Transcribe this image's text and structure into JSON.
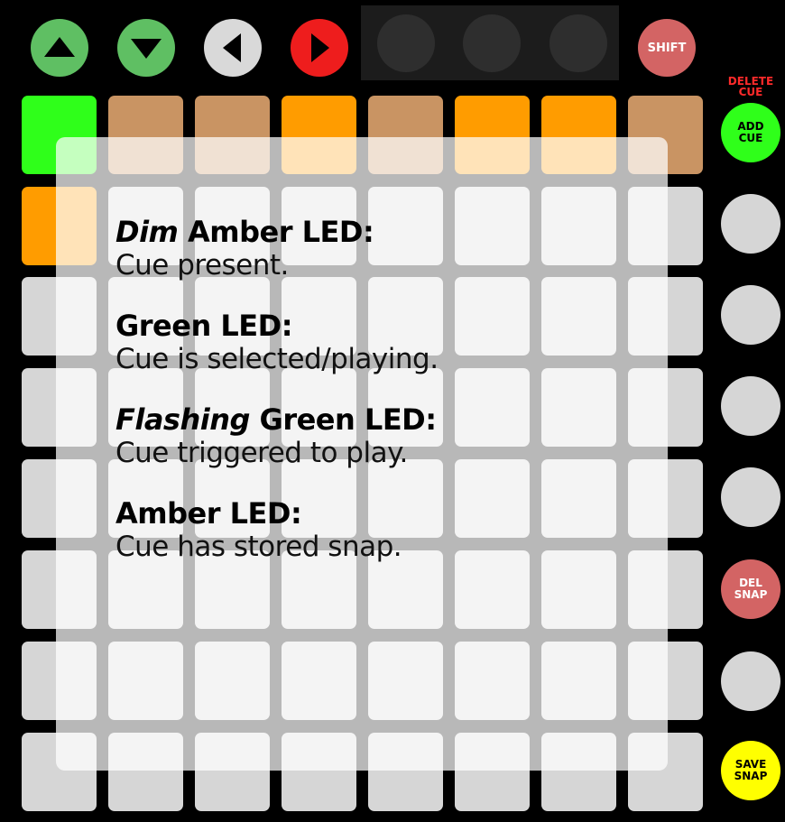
{
  "top_buttons": [
    {
      "name": "up-arrow-button",
      "icon": "triangle-up-icon",
      "color": "#5fbf63"
    },
    {
      "name": "down-arrow-button",
      "icon": "triangle-down-icon",
      "color": "#5fbf63"
    },
    {
      "name": "left-arrow-button",
      "icon": "triangle-left-icon",
      "color": "#d9d9d9"
    },
    {
      "name": "right-arrow-button",
      "icon": "triangle-right-icon",
      "color": "#ee1d1d"
    }
  ],
  "shift_label": "SHIFT",
  "delete_cue_label": "DELETE\nCUE",
  "grid": {
    "rows": [
      [
        "green",
        "amber-dim",
        "amber-dim",
        "amber",
        "amber-dim",
        "amber",
        "amber",
        "amber-dim"
      ],
      [
        "amber",
        "off",
        "off",
        "off",
        "off",
        "off",
        "off",
        "off"
      ],
      [
        "off",
        "off",
        "off",
        "off",
        "off",
        "off",
        "off",
        "off"
      ],
      [
        "off",
        "off",
        "off",
        "off",
        "off",
        "off",
        "off",
        "off"
      ],
      [
        "off",
        "off",
        "off",
        "off",
        "off",
        "off",
        "off",
        "off"
      ],
      [
        "off",
        "off",
        "off",
        "off",
        "off",
        "off",
        "off",
        "off"
      ],
      [
        "off",
        "off",
        "off",
        "off",
        "off",
        "off",
        "off",
        "off"
      ],
      [
        "off",
        "off",
        "off",
        "off",
        "off",
        "off",
        "off",
        "off"
      ]
    ],
    "colors": {
      "green": "#2fff1a",
      "amber": "#ff9c00",
      "amber-dim": "#c99463",
      "off": "#d6d6d6"
    }
  },
  "side_buttons": [
    {
      "label": "ADD\nCUE",
      "color": "#2fff1a"
    },
    {
      "label": "",
      "color": "#d6d6d6"
    },
    {
      "label": "",
      "color": "#d6d6d6"
    },
    {
      "label": "",
      "color": "#d6d6d6"
    },
    {
      "label": "",
      "color": "#d6d6d6"
    },
    {
      "label": "DEL\nSNAP",
      "color": "#d36464"
    },
    {
      "label": "",
      "color": "#d6d6d6"
    },
    {
      "label": "SAVE\nSNAP",
      "color": "#ffff00"
    }
  ],
  "legend": [
    {
      "emph": "Dim",
      "title": " Amber LED:",
      "desc": "Cue present."
    },
    {
      "emph": "",
      "title": "Green LED:",
      "desc": "Cue is selected/playing."
    },
    {
      "emph": "Flashing",
      "title": " Green LED:",
      "desc": "Cue triggered to play."
    },
    {
      "emph": "",
      "title": "Amber LED:",
      "desc": "Cue has stored snap."
    }
  ]
}
